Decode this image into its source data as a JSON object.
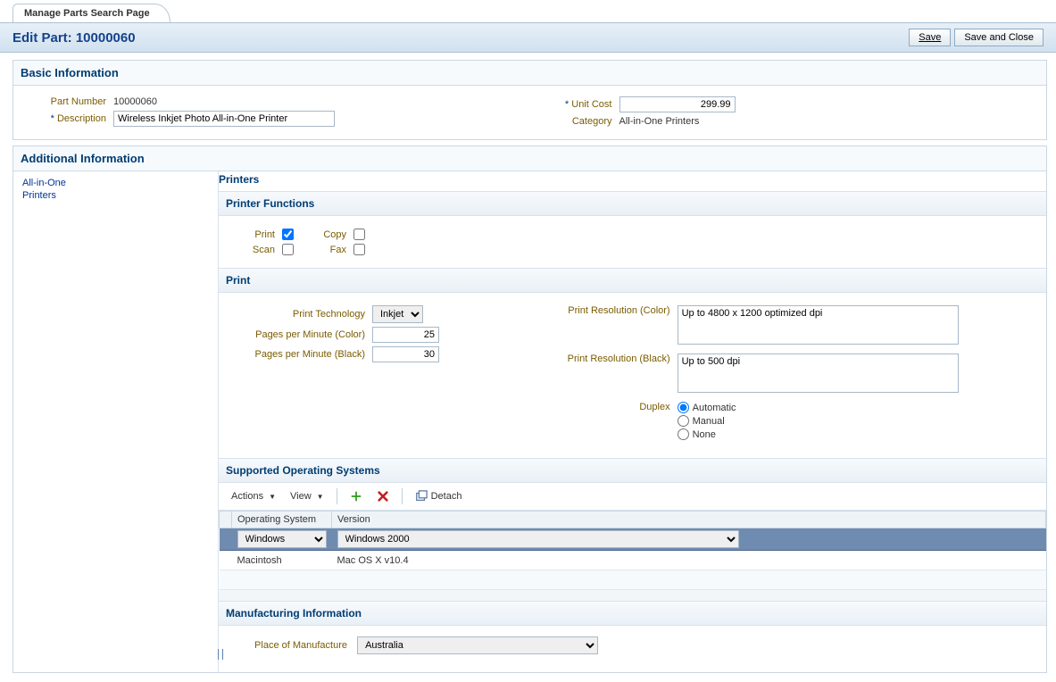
{
  "tab": {
    "label": "Manage Parts Search Page"
  },
  "header": {
    "title": "Edit Part: 10000060",
    "save_label": "Save",
    "save_close_label": "Save and Close"
  },
  "basic": {
    "title": "Basic Information",
    "part_number_label": "Part Number",
    "part_number": "10000060",
    "description_label": "Description",
    "description": "Wireless Inkjet Photo All-in-One Printer",
    "unit_cost_label": "Unit Cost",
    "unit_cost": "299.99",
    "category_label": "Category",
    "category": "All-in-One Printers"
  },
  "additional": {
    "title": "Additional Information",
    "sidebar": [
      {
        "line1": "All-in-One",
        "line2": "Printers"
      }
    ]
  },
  "printers": {
    "title": "Printers",
    "functions": {
      "title": "Printer Functions",
      "items": [
        {
          "label": "Print",
          "checked": true
        },
        {
          "label": "Copy",
          "checked": false
        },
        {
          "label": "Scan",
          "checked": false
        },
        {
          "label": "Fax",
          "checked": false
        }
      ]
    },
    "print": {
      "title": "Print",
      "tech_label": "Print Technology",
      "tech_value": "Inkjet",
      "ppm_color_label": "Pages per Minute (Color)",
      "ppm_color": "25",
      "ppm_black_label": "Pages per Minute (Black)",
      "ppm_black": "30",
      "res_color_label": "Print Resolution (Color)",
      "res_color": "Up to 4800 x 1200 optimized dpi",
      "res_black_label": "Print Resolution (Black)",
      "res_black": "Up to 500 dpi",
      "duplex_label": "Duplex",
      "duplex_options": [
        "Automatic",
        "Manual",
        "None"
      ],
      "duplex_selected": "Automatic"
    }
  },
  "os": {
    "title": "Supported Operating Systems",
    "toolbar": {
      "actions": "Actions",
      "view": "View",
      "detach": "Detach"
    },
    "columns": [
      "Operating System",
      "Version"
    ],
    "rows": [
      {
        "os": "Windows",
        "version": "Windows 2000"
      },
      {
        "os": "Macintosh",
        "version": "Mac OS X v10.4"
      }
    ]
  },
  "manuf": {
    "title": "Manufacturing Information",
    "pom_label": "Place of Manufacture",
    "pom_value": "Australia"
  }
}
